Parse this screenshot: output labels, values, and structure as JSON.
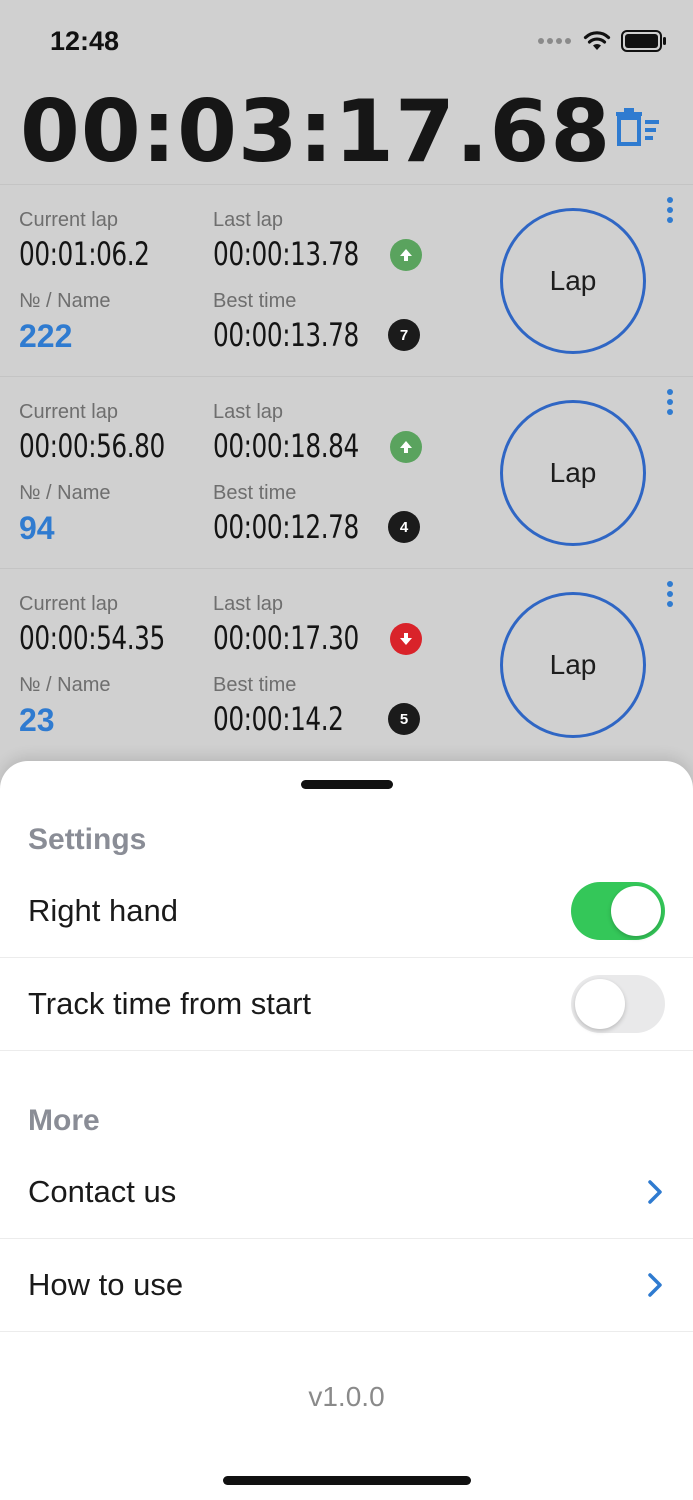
{
  "status_bar": {
    "time": "12:48"
  },
  "header": {
    "elapsed": "00:03:17.68",
    "trash_icon": "delete-list-icon",
    "accent": "#2f7bd0"
  },
  "labels": {
    "current_lap": "Current lap",
    "last_lap": "Last lap",
    "name": "№ / Name",
    "best_time": "Best time",
    "lap_button": "Lap"
  },
  "laps": [
    {
      "current_lap": "00:01:06.2",
      "last_lap": "00:00:13.78",
      "trend": "up",
      "name": "222",
      "best_time": "00:00:13.78",
      "rank": "7"
    },
    {
      "current_lap": "00:00:56.80",
      "last_lap": "00:00:18.84",
      "trend": "up",
      "name": "94",
      "best_time": "00:00:12.78",
      "rank": "4"
    },
    {
      "current_lap": "00:00:54.35",
      "last_lap": "00:00:17.30",
      "trend": "down",
      "name": "23",
      "best_time": "00:00:14.2",
      "rank": "5"
    }
  ],
  "sheet": {
    "settings_title": "Settings",
    "settings": [
      {
        "label": "Right hand",
        "enabled": true
      },
      {
        "label": "Track time from start",
        "enabled": false
      }
    ],
    "more_title": "More",
    "more": [
      {
        "label": "Contact us"
      },
      {
        "label": "How to use"
      }
    ],
    "version": "v1.0.0"
  },
  "colors": {
    "toggle_on": "#34c759",
    "trend_up": "#5aa35e",
    "trend_down": "#d9232a",
    "lap_ring": "#2f66c4"
  }
}
